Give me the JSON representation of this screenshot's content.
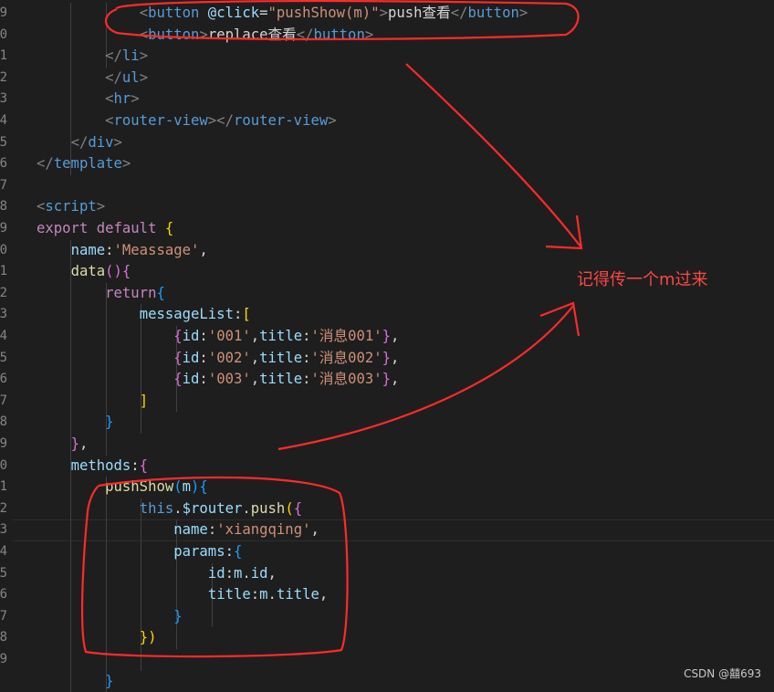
{
  "line_numbers": [
    "9",
    "0",
    "1",
    "2",
    "3",
    "4",
    "5",
    "6",
    "7",
    "8",
    "9",
    "0",
    "1",
    "2",
    "3",
    "4",
    "5",
    "6",
    "7",
    "8",
    "9",
    "0",
    "1",
    "2",
    "3",
    "4",
    "5",
    "6",
    "7",
    "8",
    "9",
    ""
  ],
  "code_lines": [
    [
      [
        "    ",
        "t-def"
      ],
      [
        "    ",
        "t-def"
      ],
      [
        "    ",
        "t-def"
      ],
      [
        "<",
        "t-punc"
      ],
      [
        "button",
        "t-tag"
      ],
      [
        " @click",
        "t-attr"
      ],
      [
        "=",
        "t-def"
      ],
      [
        "\"pushShow(m)\"",
        "t-str"
      ],
      [
        ">",
        "t-punc"
      ],
      [
        "push查看",
        "t-def"
      ],
      [
        "</",
        "t-punc"
      ],
      [
        "button",
        "t-tag"
      ],
      [
        ">",
        "t-punc"
      ]
    ],
    [
      [
        "    ",
        "t-def"
      ],
      [
        "    ",
        "t-def"
      ],
      [
        "    ",
        "t-def"
      ],
      [
        "<",
        "t-punc"
      ],
      [
        "button",
        "t-tag"
      ],
      [
        ">",
        "t-punc"
      ],
      [
        "replace查看",
        "t-def"
      ],
      [
        "</",
        "t-punc"
      ],
      [
        "button",
        "t-tag"
      ],
      [
        ">",
        "t-punc"
      ]
    ],
    [
      [
        "    ",
        "t-def"
      ],
      [
        "    ",
        "t-def"
      ],
      [
        "</",
        "t-punc"
      ],
      [
        "li",
        "t-tag"
      ],
      [
        ">",
        "t-punc"
      ]
    ],
    [
      [
        "    ",
        "t-def"
      ],
      [
        "    ",
        "t-def"
      ],
      [
        "</",
        "t-punc"
      ],
      [
        "ul",
        "t-tag"
      ],
      [
        ">",
        "t-punc"
      ]
    ],
    [
      [
        "    ",
        "t-def"
      ],
      [
        "    ",
        "t-def"
      ],
      [
        "<",
        "t-punc"
      ],
      [
        "hr",
        "t-tag"
      ],
      [
        ">",
        "t-punc"
      ]
    ],
    [
      [
        "    ",
        "t-def"
      ],
      [
        "    ",
        "t-def"
      ],
      [
        "<",
        "t-punc"
      ],
      [
        "router-view",
        "t-tag"
      ],
      [
        "></",
        "t-punc"
      ],
      [
        "router-view",
        "t-tag"
      ],
      [
        ">",
        "t-punc"
      ]
    ],
    [
      [
        "    ",
        "t-def"
      ],
      [
        "</",
        "t-punc"
      ],
      [
        "div",
        "t-tag"
      ],
      [
        ">",
        "t-punc"
      ]
    ],
    [
      [
        "</",
        "t-punc"
      ],
      [
        "template",
        "t-tag"
      ],
      [
        ">",
        "t-punc"
      ]
    ],
    [
      [
        "",
        "t-def"
      ]
    ],
    [
      [
        "<",
        "t-punc"
      ],
      [
        "script",
        "t-tag"
      ],
      [
        ">",
        "t-punc"
      ]
    ],
    [
      [
        "export",
        "t-kw"
      ],
      [
        " ",
        "t-def"
      ],
      [
        "default",
        "t-kw"
      ],
      [
        " ",
        "t-def"
      ],
      [
        "{",
        "t-br1"
      ]
    ],
    [
      [
        "    ",
        "t-def"
      ],
      [
        "name",
        "t-var"
      ],
      [
        ":",
        "t-def"
      ],
      [
        "'Meassage'",
        "t-str"
      ],
      [
        ",",
        "t-def"
      ]
    ],
    [
      [
        "    ",
        "t-def"
      ],
      [
        "data",
        "t-fn"
      ],
      [
        "()",
        "t-br2"
      ],
      [
        "{",
        "t-br2"
      ]
    ],
    [
      [
        "    ",
        "t-def"
      ],
      [
        "    ",
        "t-def"
      ],
      [
        "return",
        "t-kw"
      ],
      [
        "{",
        "t-br3"
      ]
    ],
    [
      [
        "    ",
        "t-def"
      ],
      [
        "    ",
        "t-def"
      ],
      [
        "    ",
        "t-def"
      ],
      [
        "messageList",
        "t-var"
      ],
      [
        ":",
        "t-def"
      ],
      [
        "[",
        "t-br1"
      ]
    ],
    [
      [
        "    ",
        "t-def"
      ],
      [
        "    ",
        "t-def"
      ],
      [
        "    ",
        "t-def"
      ],
      [
        "    ",
        "t-def"
      ],
      [
        "{",
        "t-br2"
      ],
      [
        "id",
        "t-var"
      ],
      [
        ":",
        "t-def"
      ],
      [
        "'001'",
        "t-str"
      ],
      [
        ",",
        "t-def"
      ],
      [
        "title",
        "t-var"
      ],
      [
        ":",
        "t-def"
      ],
      [
        "'消息001'",
        "t-str"
      ],
      [
        "}",
        "t-br2"
      ],
      [
        ",",
        "t-def"
      ]
    ],
    [
      [
        "    ",
        "t-def"
      ],
      [
        "    ",
        "t-def"
      ],
      [
        "    ",
        "t-def"
      ],
      [
        "    ",
        "t-def"
      ],
      [
        "{",
        "t-br2"
      ],
      [
        "id",
        "t-var"
      ],
      [
        ":",
        "t-def"
      ],
      [
        "'002'",
        "t-str"
      ],
      [
        ",",
        "t-def"
      ],
      [
        "title",
        "t-var"
      ],
      [
        ":",
        "t-def"
      ],
      [
        "'消息002'",
        "t-str"
      ],
      [
        "}",
        "t-br2"
      ],
      [
        ",",
        "t-def"
      ]
    ],
    [
      [
        "    ",
        "t-def"
      ],
      [
        "    ",
        "t-def"
      ],
      [
        "    ",
        "t-def"
      ],
      [
        "    ",
        "t-def"
      ],
      [
        "{",
        "t-br2"
      ],
      [
        "id",
        "t-var"
      ],
      [
        ":",
        "t-def"
      ],
      [
        "'003'",
        "t-str"
      ],
      [
        ",",
        "t-def"
      ],
      [
        "title",
        "t-var"
      ],
      [
        ":",
        "t-def"
      ],
      [
        "'消息003'",
        "t-str"
      ],
      [
        "}",
        "t-br2"
      ],
      [
        ",",
        "t-def"
      ]
    ],
    [
      [
        "    ",
        "t-def"
      ],
      [
        "    ",
        "t-def"
      ],
      [
        "    ",
        "t-def"
      ],
      [
        "]",
        "t-br1"
      ]
    ],
    [
      [
        "    ",
        "t-def"
      ],
      [
        "    ",
        "t-def"
      ],
      [
        "}",
        "t-br3"
      ]
    ],
    [
      [
        "    ",
        "t-def"
      ],
      [
        "}",
        "t-br2"
      ],
      [
        ",",
        "t-def"
      ]
    ],
    [
      [
        "    ",
        "t-def"
      ],
      [
        "methods",
        "t-var"
      ],
      [
        ":",
        "t-def"
      ],
      [
        "{",
        "t-br2"
      ]
    ],
    [
      [
        "    ",
        "t-def"
      ],
      [
        "    ",
        "t-def"
      ],
      [
        "pushShow",
        "t-fn"
      ],
      [
        "(",
        "t-br3"
      ],
      [
        "m",
        "t-var"
      ],
      [
        ")",
        "t-br3"
      ],
      [
        "{",
        "t-br3"
      ]
    ],
    [
      [
        "    ",
        "t-def"
      ],
      [
        "    ",
        "t-def"
      ],
      [
        "    ",
        "t-def"
      ],
      [
        "this",
        "t-this"
      ],
      [
        ".",
        "t-def"
      ],
      [
        "$router",
        "t-var"
      ],
      [
        ".",
        "t-def"
      ],
      [
        "push",
        "t-fn"
      ],
      [
        "(",
        "t-br1"
      ],
      [
        "{",
        "t-br2"
      ]
    ],
    [
      [
        "    ",
        "t-def"
      ],
      [
        "    ",
        "t-def"
      ],
      [
        "    ",
        "t-def"
      ],
      [
        "    ",
        "t-def"
      ],
      [
        "name",
        "t-var"
      ],
      [
        ":",
        "t-def"
      ],
      [
        "'xiangqing'",
        "t-str"
      ],
      [
        ",",
        "t-def"
      ]
    ],
    [
      [
        "    ",
        "t-def"
      ],
      [
        "    ",
        "t-def"
      ],
      [
        "    ",
        "t-def"
      ],
      [
        "    ",
        "t-def"
      ],
      [
        "params",
        "t-var"
      ],
      [
        ":",
        "t-def"
      ],
      [
        "{",
        "t-br3"
      ]
    ],
    [
      [
        "    ",
        "t-def"
      ],
      [
        "    ",
        "t-def"
      ],
      [
        "    ",
        "t-def"
      ],
      [
        "    ",
        "t-def"
      ],
      [
        "    ",
        "t-def"
      ],
      [
        "id",
        "t-var"
      ],
      [
        ":",
        "t-def"
      ],
      [
        "m",
        "t-var"
      ],
      [
        ".",
        "t-def"
      ],
      [
        "id",
        "t-var"
      ],
      [
        ",",
        "t-def"
      ]
    ],
    [
      [
        "    ",
        "t-def"
      ],
      [
        "    ",
        "t-def"
      ],
      [
        "    ",
        "t-def"
      ],
      [
        "    ",
        "t-def"
      ],
      [
        "    ",
        "t-def"
      ],
      [
        "title",
        "t-var"
      ],
      [
        ":",
        "t-def"
      ],
      [
        "m",
        "t-var"
      ],
      [
        ".",
        "t-def"
      ],
      [
        "title",
        "t-var"
      ],
      [
        ",",
        "t-def"
      ]
    ],
    [
      [
        "    ",
        "t-def"
      ],
      [
        "    ",
        "t-def"
      ],
      [
        "    ",
        "t-def"
      ],
      [
        "    ",
        "t-def"
      ],
      [
        "}",
        "t-br3"
      ]
    ],
    [
      [
        "    ",
        "t-def"
      ],
      [
        "    ",
        "t-def"
      ],
      [
        "    ",
        "t-def"
      ],
      [
        "})",
        "t-br1"
      ]
    ],
    [
      [
        "",
        "t-def"
      ]
    ],
    [
      [
        "    ",
        "t-def"
      ],
      [
        "    ",
        "t-def"
      ],
      [
        "}",
        "t-br3"
      ]
    ]
  ],
  "annotation": {
    "note_text": "记得传一个m过来",
    "color": "#ff3030"
  },
  "watermark": "CSDN @囍693",
  "colors": {
    "background": "#1e1e1e",
    "line_number": "#858585",
    "tag": "#569cd6",
    "string": "#ce9178",
    "keyword": "#c586c0",
    "function": "#dcdcaa",
    "variable": "#9cdcfe"
  }
}
